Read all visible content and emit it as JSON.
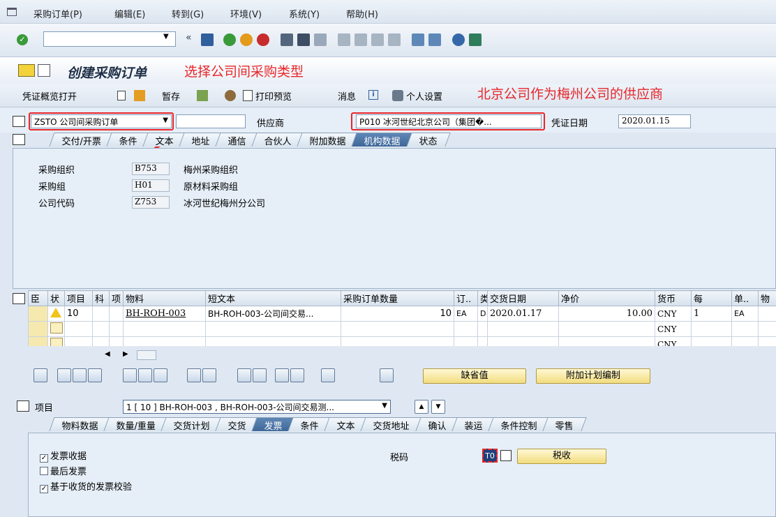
{
  "menu": [
    "采购订单(P)",
    "编辑(E)",
    "转到(G)",
    "环境(V)",
    "系统(Y)",
    "帮助(H)"
  ],
  "window_title": "创建采购订单",
  "annotations": {
    "top": "选择公司间采购类型",
    "right": "北京公司作为梅州公司的供应商"
  },
  "app_toolbar": {
    "overview": "凭证概览打开",
    "hold": "暂存",
    "print_preview": "打印预览",
    "messages": "消息",
    "personal": "个人设置"
  },
  "header": {
    "order_type": "ZSTO 公司间采购订单",
    "vendor_label": "供应商",
    "vendor": "P010 冰河世纪北京公司（集团�...",
    "doc_date_label": "凭证日期",
    "doc_date": "2020.01.15"
  },
  "header_tabs": [
    "交付/开票",
    "条件",
    "文本",
    "地址",
    "通信",
    "合伙人",
    "附加数据",
    "机构数据",
    "状态"
  ],
  "org": [
    {
      "label": "采购组织",
      "code": "B753",
      "text": "梅州采购组织"
    },
    {
      "label": "采购组",
      "code": "H01",
      "text": "原材料采购组"
    },
    {
      "label": "公司代码",
      "code": "Z753",
      "text": "冰河世纪梅州分公司"
    }
  ],
  "items_table": {
    "columns": [
      "臣",
      "状",
      "项目",
      "科",
      "项",
      "物料",
      "短文本",
      "采购订单数量",
      "订..",
      "类",
      "交货日期",
      "净价",
      "货币",
      "每",
      "单..",
      "物"
    ],
    "rows": [
      {
        "item": "10",
        "material": "BH-ROH-003",
        "short_text": "BH-ROH-003-公司间交易...",
        "qty": "10",
        "unit": "EA",
        "cat": "D",
        "date": "2020.01.17",
        "price": "10.00",
        "currency": "CNY",
        "per": "1",
        "ou": "EA"
      },
      {
        "currency": "CNY"
      },
      {
        "currency": "CNY"
      }
    ]
  },
  "buttons": {
    "default_values": "缺省值",
    "add_planning": "附加计划编制"
  },
  "item_detail": {
    "label": "项目",
    "selector": "1 [ 10 ] BH-ROH-003 , BH-ROH-003-公司间交易测..."
  },
  "item_tabs": [
    "物料数据",
    "数量/重量",
    "交货计划",
    "交货",
    "发票",
    "条件",
    "文本",
    "交货地址",
    "确认",
    "装运",
    "条件控制",
    "零售"
  ],
  "invoice": {
    "checks": [
      {
        "label": "发票收据",
        "checked": true
      },
      {
        "label": "最后发票",
        "checked": false
      },
      {
        "label": "基于收货的发票校验",
        "checked": true
      }
    ],
    "tax_label": "税码",
    "tax_code": "T0",
    "tax_button": "税收"
  }
}
